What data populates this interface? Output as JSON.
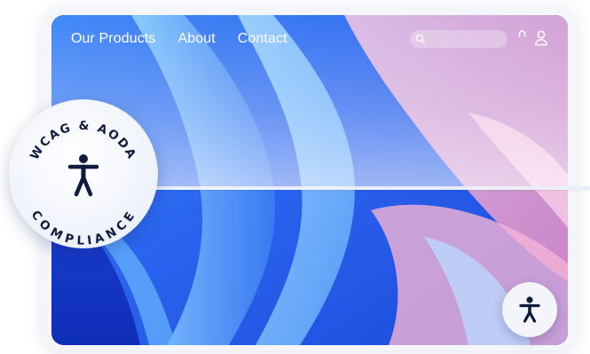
{
  "nav": {
    "items": [
      {
        "label": "Our Products"
      },
      {
        "label": "About"
      },
      {
        "label": "Contact"
      }
    ]
  },
  "search": {
    "placeholder": "",
    "icon": "search-icon"
  },
  "header_icons": [
    "arc-icon",
    "user-icon"
  ],
  "badge": {
    "top_text": "WCAG & AODA",
    "bottom_text": "COMPLIANCE",
    "icon": "accessibility-icon"
  },
  "floating_button": {
    "icon": "accessibility-icon"
  },
  "colors": {
    "primary_blue": "#2f6bf2",
    "deep_blue": "#1a3fd6",
    "pink": "#f3a6cf",
    "navy": "#0f1b3d"
  }
}
